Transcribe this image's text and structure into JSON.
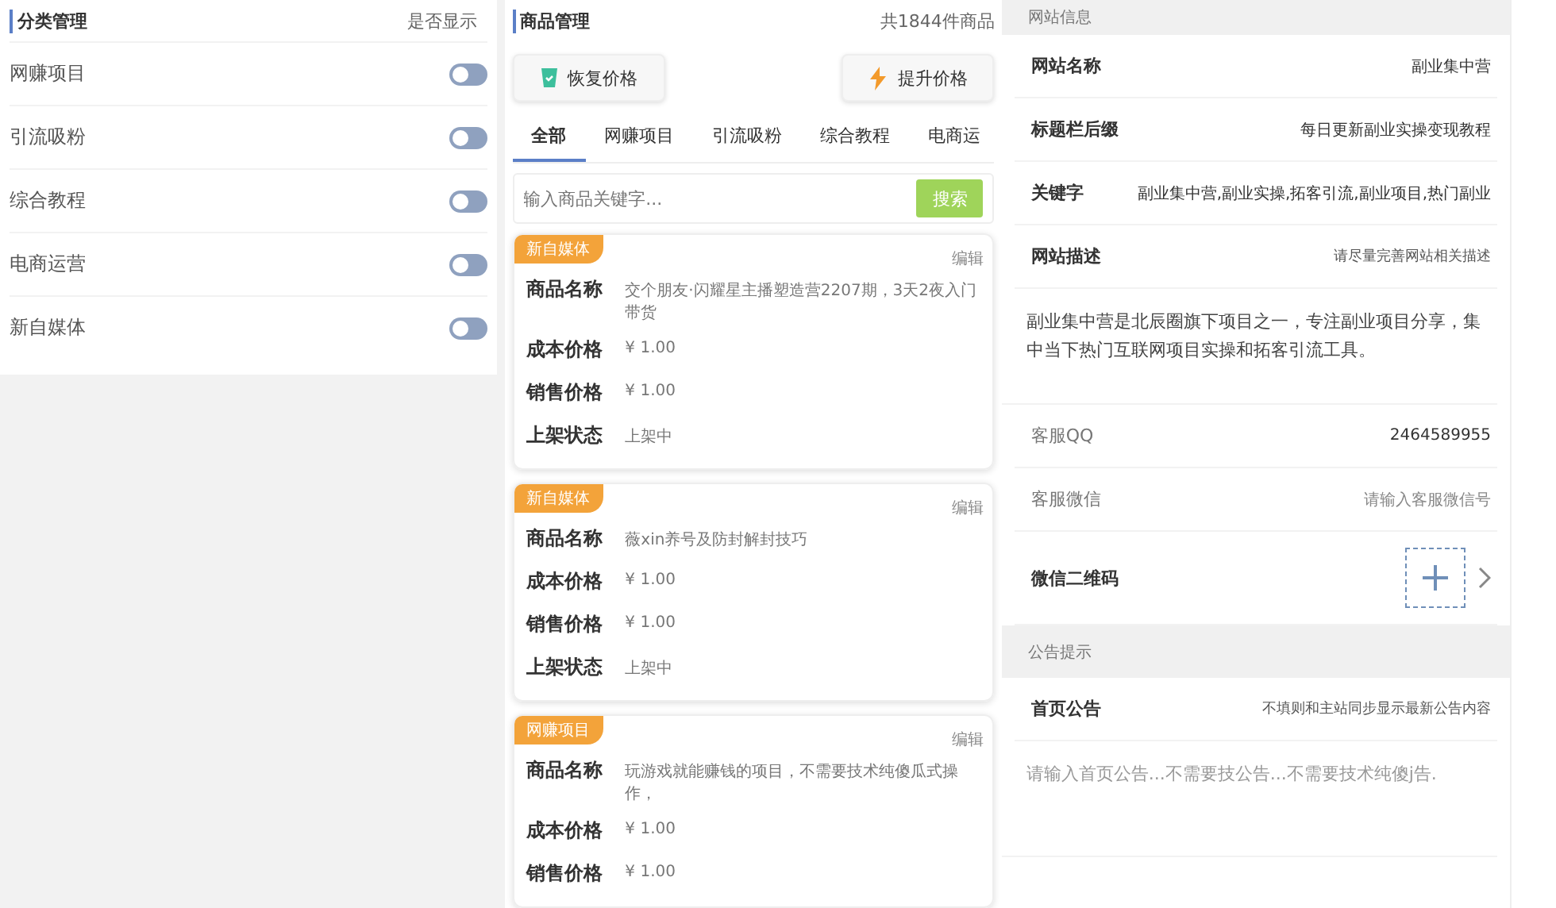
{
  "category_panel": {
    "title": "分类管理",
    "column_label": "是否显示",
    "items": [
      {
        "name": "网赚项目",
        "on": false
      },
      {
        "name": "引流吸粉",
        "on": false
      },
      {
        "name": "综合教程",
        "on": false
      },
      {
        "name": "电商运营",
        "on": false
      },
      {
        "name": "新自媒体",
        "on": false
      }
    ]
  },
  "product_panel": {
    "title": "商品管理",
    "count": "共1844件商品",
    "buttons": [
      {
        "label": "恢复价格",
        "kind": "restore"
      },
      {
        "label": "提升价格",
        "kind": "raise"
      }
    ],
    "tabs": [
      {
        "label": "全部",
        "selected": true
      },
      {
        "label": "网赚项目",
        "selected": false
      },
      {
        "label": "引流吸粉",
        "selected": false
      },
      {
        "label": "综合教程",
        "selected": false
      },
      {
        "label": "电商运",
        "selected": false
      }
    ],
    "search": {
      "placeholder": "输入商品关键字...",
      "button": "搜索"
    },
    "products": [
      {
        "tag": "新自媒体",
        "edit": "编辑",
        "fields": [
          {
            "label": "商品名称",
            "value": "交个朋友·闪耀星主播塑造营2207期，3天2夜入门带货"
          },
          {
            "label": "成本价格",
            "value": "¥ 1.00"
          },
          {
            "label": "销售价格",
            "value": "¥ 1.00"
          },
          {
            "label": "上架状态",
            "value": "上架中"
          }
        ]
      },
      {
        "tag": "新自媒体",
        "edit": "编辑",
        "fields": [
          {
            "label": "商品名称",
            "value": "薇xin养号及防封解封技巧"
          },
          {
            "label": "成本价格",
            "value": "¥ 1.00"
          },
          {
            "label": "销售价格",
            "value": "¥ 1.00"
          },
          {
            "label": "上架状态",
            "value": "上架中"
          }
        ]
      },
      {
        "tag": "网赚项目",
        "edit": "编辑",
        "fields": [
          {
            "label": "商品名称",
            "value": "玩游戏就能赚钱的项目，不需要技术纯傻瓜式操作，"
          },
          {
            "label": "成本价格",
            "value": "¥ 1.00"
          },
          {
            "label": "销售价格",
            "value": "¥ 1.00"
          }
        ]
      }
    ]
  },
  "site_panel": {
    "rows": [
      {
        "kind": "header",
        "label": "网站信息"
      },
      {
        "kind": "field",
        "label": "网站名称",
        "value": "副业集中营"
      },
      {
        "kind": "field",
        "label": "标题栏后缀",
        "value": "每日更新副业实操变现教程"
      },
      {
        "kind": "field",
        "label": "关键字",
        "value": "副业集中营,副业实操,拓客引流,副业项目,热门副业"
      },
      {
        "kind": "field",
        "label": "网站描述",
        "hint": "请尽量完善网站相关描述"
      },
      {
        "kind": "textarea",
        "value": "副业集中营是北辰圈旗下项目之一，专注副业项目分享，集中当下热门互联网项目实操和拓客引流工具。"
      },
      {
        "kind": "light-field",
        "label": "客服QQ",
        "value": "2464589955"
      },
      {
        "kind": "light-field",
        "label": "客服微信",
        "placeholder": "请输入客服微信号"
      },
      {
        "kind": "upload",
        "label": "微信二维码"
      },
      {
        "kind": "header",
        "label": "公告提示"
      },
      {
        "kind": "field",
        "label": "首页公告",
        "hint": "不填则和主站同步显示最新公告内容"
      },
      {
        "kind": "textarea",
        "placeholder": "请输入首页公告...不需要技公告...不需要技术纯傻j告."
      }
    ]
  }
}
